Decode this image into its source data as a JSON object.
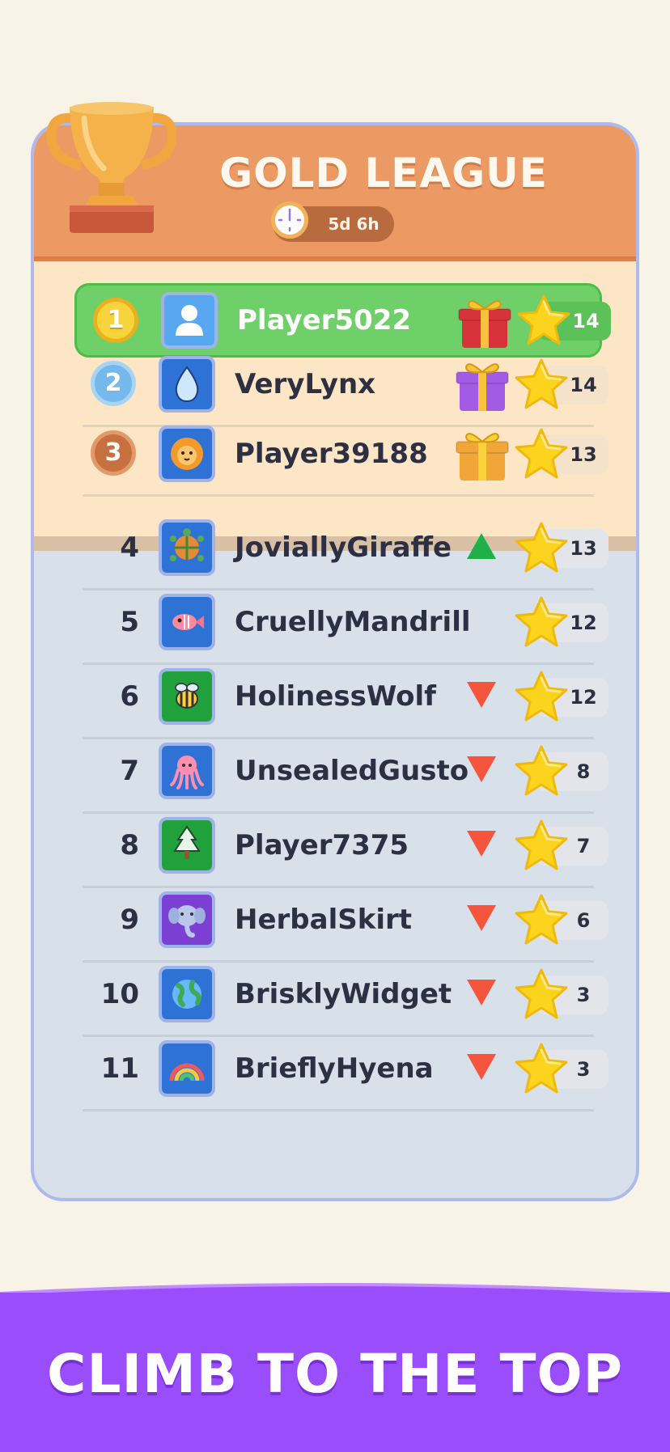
{
  "league": {
    "title": "GOLD LEAGUE",
    "timer": "5d 6h",
    "header_color": "#ec9a64"
  },
  "players": [
    {
      "rank": "1",
      "name": "Player5022",
      "score": "14",
      "avatar": "person-icon",
      "reward": "red-gift-icon",
      "highlight": true
    },
    {
      "rank": "2",
      "name": "VeryLynx",
      "score": "14",
      "avatar": "water-drop-icon",
      "reward": "purple-gift-icon"
    },
    {
      "rank": "3",
      "name": "Player39188",
      "score": "13",
      "avatar": "lion-icon",
      "reward": "gold-gift-icon"
    },
    {
      "rank": "4",
      "name": "JoviallyGiraffe",
      "score": "13",
      "avatar": "turtle-icon",
      "trend": "up"
    },
    {
      "rank": "5",
      "name": "CruellyMandrill",
      "score": "12",
      "avatar": "fish-icon",
      "trend": "none"
    },
    {
      "rank": "6",
      "name": "HolinessWolf",
      "score": "12",
      "avatar": "bee-icon",
      "trend": "down"
    },
    {
      "rank": "7",
      "name": "UnsealedGusto",
      "score": "8",
      "avatar": "octopus-icon",
      "trend": "down"
    },
    {
      "rank": "8",
      "name": "Player7375",
      "score": "7",
      "avatar": "tree-icon",
      "trend": "down"
    },
    {
      "rank": "9",
      "name": "HerbalSkirt",
      "score": "6",
      "avatar": "elephant-icon",
      "trend": "down"
    },
    {
      "rank": "10",
      "name": "BrisklyWidget",
      "score": "3",
      "avatar": "globe-icon",
      "trend": "down"
    },
    {
      "rank": "11",
      "name": "BrieflyHyena",
      "score": "3",
      "avatar": "rainbow-icon",
      "trend": "down"
    }
  ],
  "banner": {
    "tagline": "CLIMB TO THE TOP",
    "color": "#9a4dfa"
  }
}
